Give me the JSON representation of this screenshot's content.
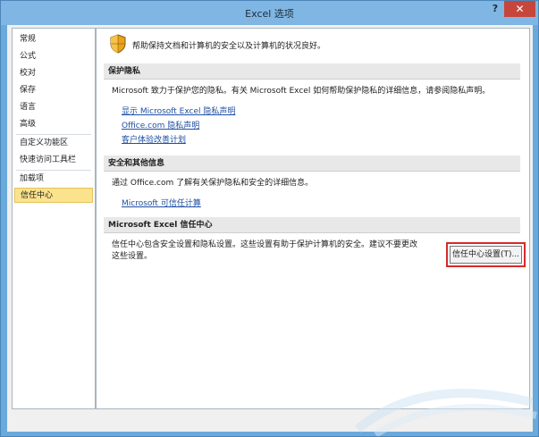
{
  "window": {
    "title": "Excel 选项",
    "help_label": "?",
    "close_label": "✕"
  },
  "sidebar": {
    "items": [
      {
        "label": "常规"
      },
      {
        "label": "公式"
      },
      {
        "label": "校对"
      },
      {
        "label": "保存"
      },
      {
        "label": "语言"
      },
      {
        "label": "高级"
      },
      {
        "label": "自定义功能区"
      },
      {
        "label": "快速访问工具栏"
      },
      {
        "label": "加载项"
      },
      {
        "label": "信任中心"
      }
    ],
    "selected": "信任中心"
  },
  "content": {
    "intro": "帮助保持文档和计算机的安全以及计算机的状况良好。",
    "privacy": {
      "header": "保护隐私",
      "text": "Microsoft 致力于保护您的隐私。有关 Microsoft Excel 如何帮助保护隐私的详细信息，请参阅隐私声明。",
      "links": [
        "显示 Microsoft Excel 隐私声明",
        "Office.com 隐私声明",
        "客户体验改善计划"
      ]
    },
    "security": {
      "header": "安全和其他信息",
      "text": "通过 Office.com 了解有关保护隐私和安全的详细信息。",
      "link": "Microsoft 可信任计算"
    },
    "trust_center": {
      "header": "Microsoft Excel 信任中心",
      "text_line1": "信任中心包含安全设置和隐私设置。这些设置有助于保护计算机的安全。建议不要更改",
      "text_line2": "这些设置。",
      "button_label": "信任中心设置(T)..."
    }
  },
  "colors": {
    "title_bar": "#7fb6e3",
    "close_button": "#c7463b",
    "selected_item": "#fbe28c",
    "link": "#1f4fa3",
    "highlight_frame": "#d42a2a"
  }
}
